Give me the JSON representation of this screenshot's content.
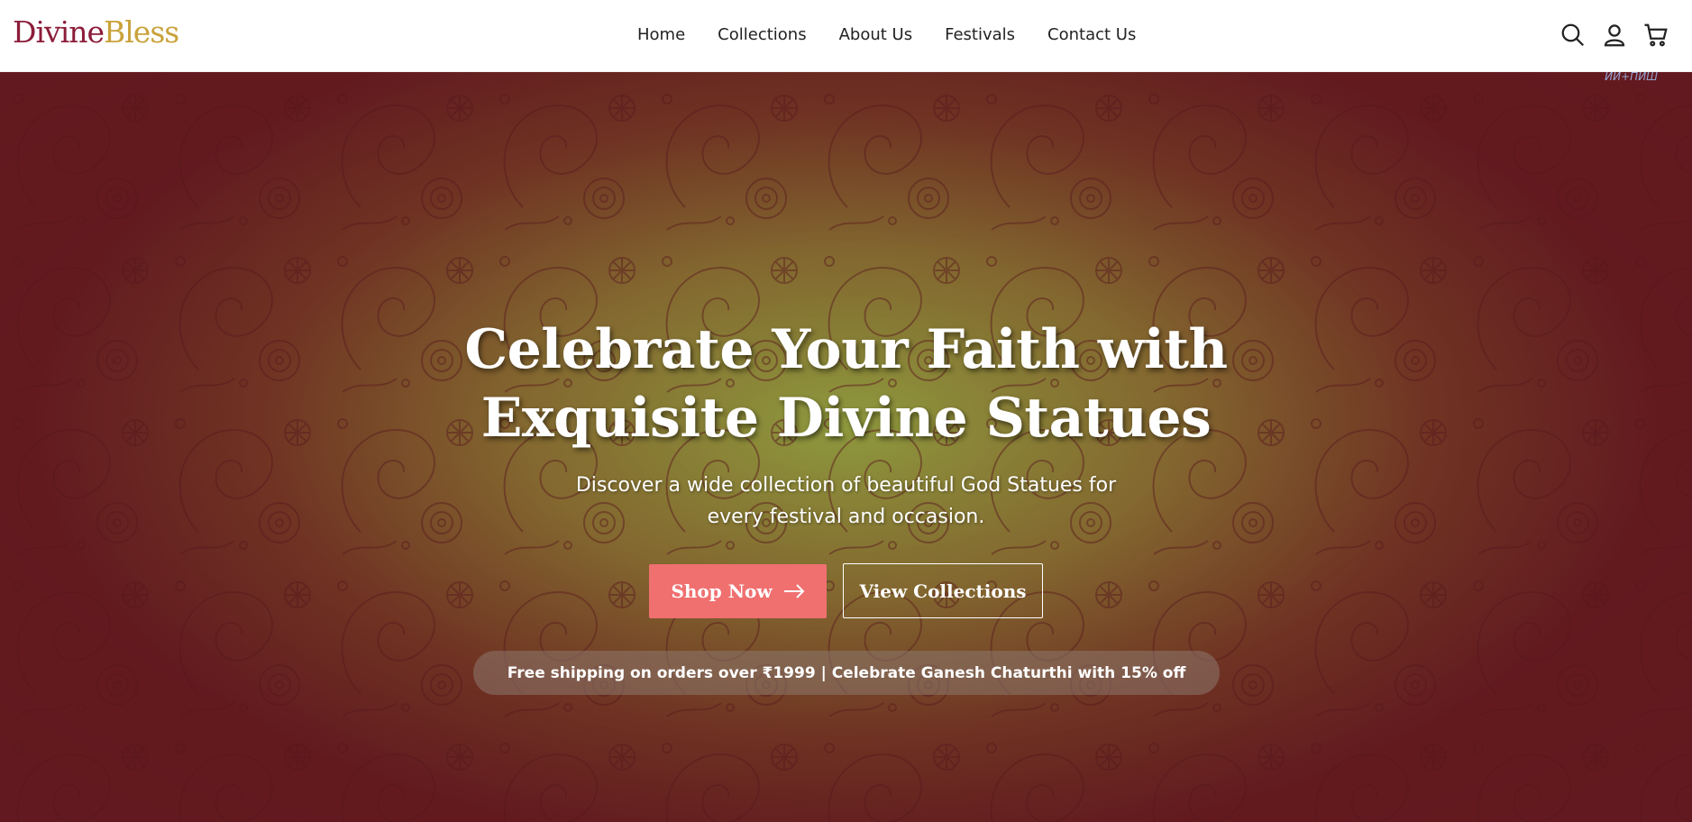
{
  "brand": {
    "part1": "Divine",
    "part2": "Bless",
    "color1": "#8c1d3a",
    "color2": "#c9a23a"
  },
  "nav": {
    "links": [
      "Home",
      "Collections",
      "About Us",
      "Festivals",
      "Contact Us"
    ],
    "icons": [
      "search-icon",
      "user-icon",
      "cart-icon"
    ]
  },
  "hero": {
    "watermark": "ИИ+ПИШ",
    "title_line1": "Celebrate Your Faith with",
    "title_line2": "Exquisite Divine Statues",
    "subtitle": "Discover a wide collection of beautiful God Statues for every festival and occasion.",
    "shop_button": "Shop Now",
    "collections_button": "View Collections",
    "promo": "Free shipping on orders over ₹1999 | Celebrate Ganesh Chaturthi with 15% off",
    "accent_color": "#f07070"
  }
}
